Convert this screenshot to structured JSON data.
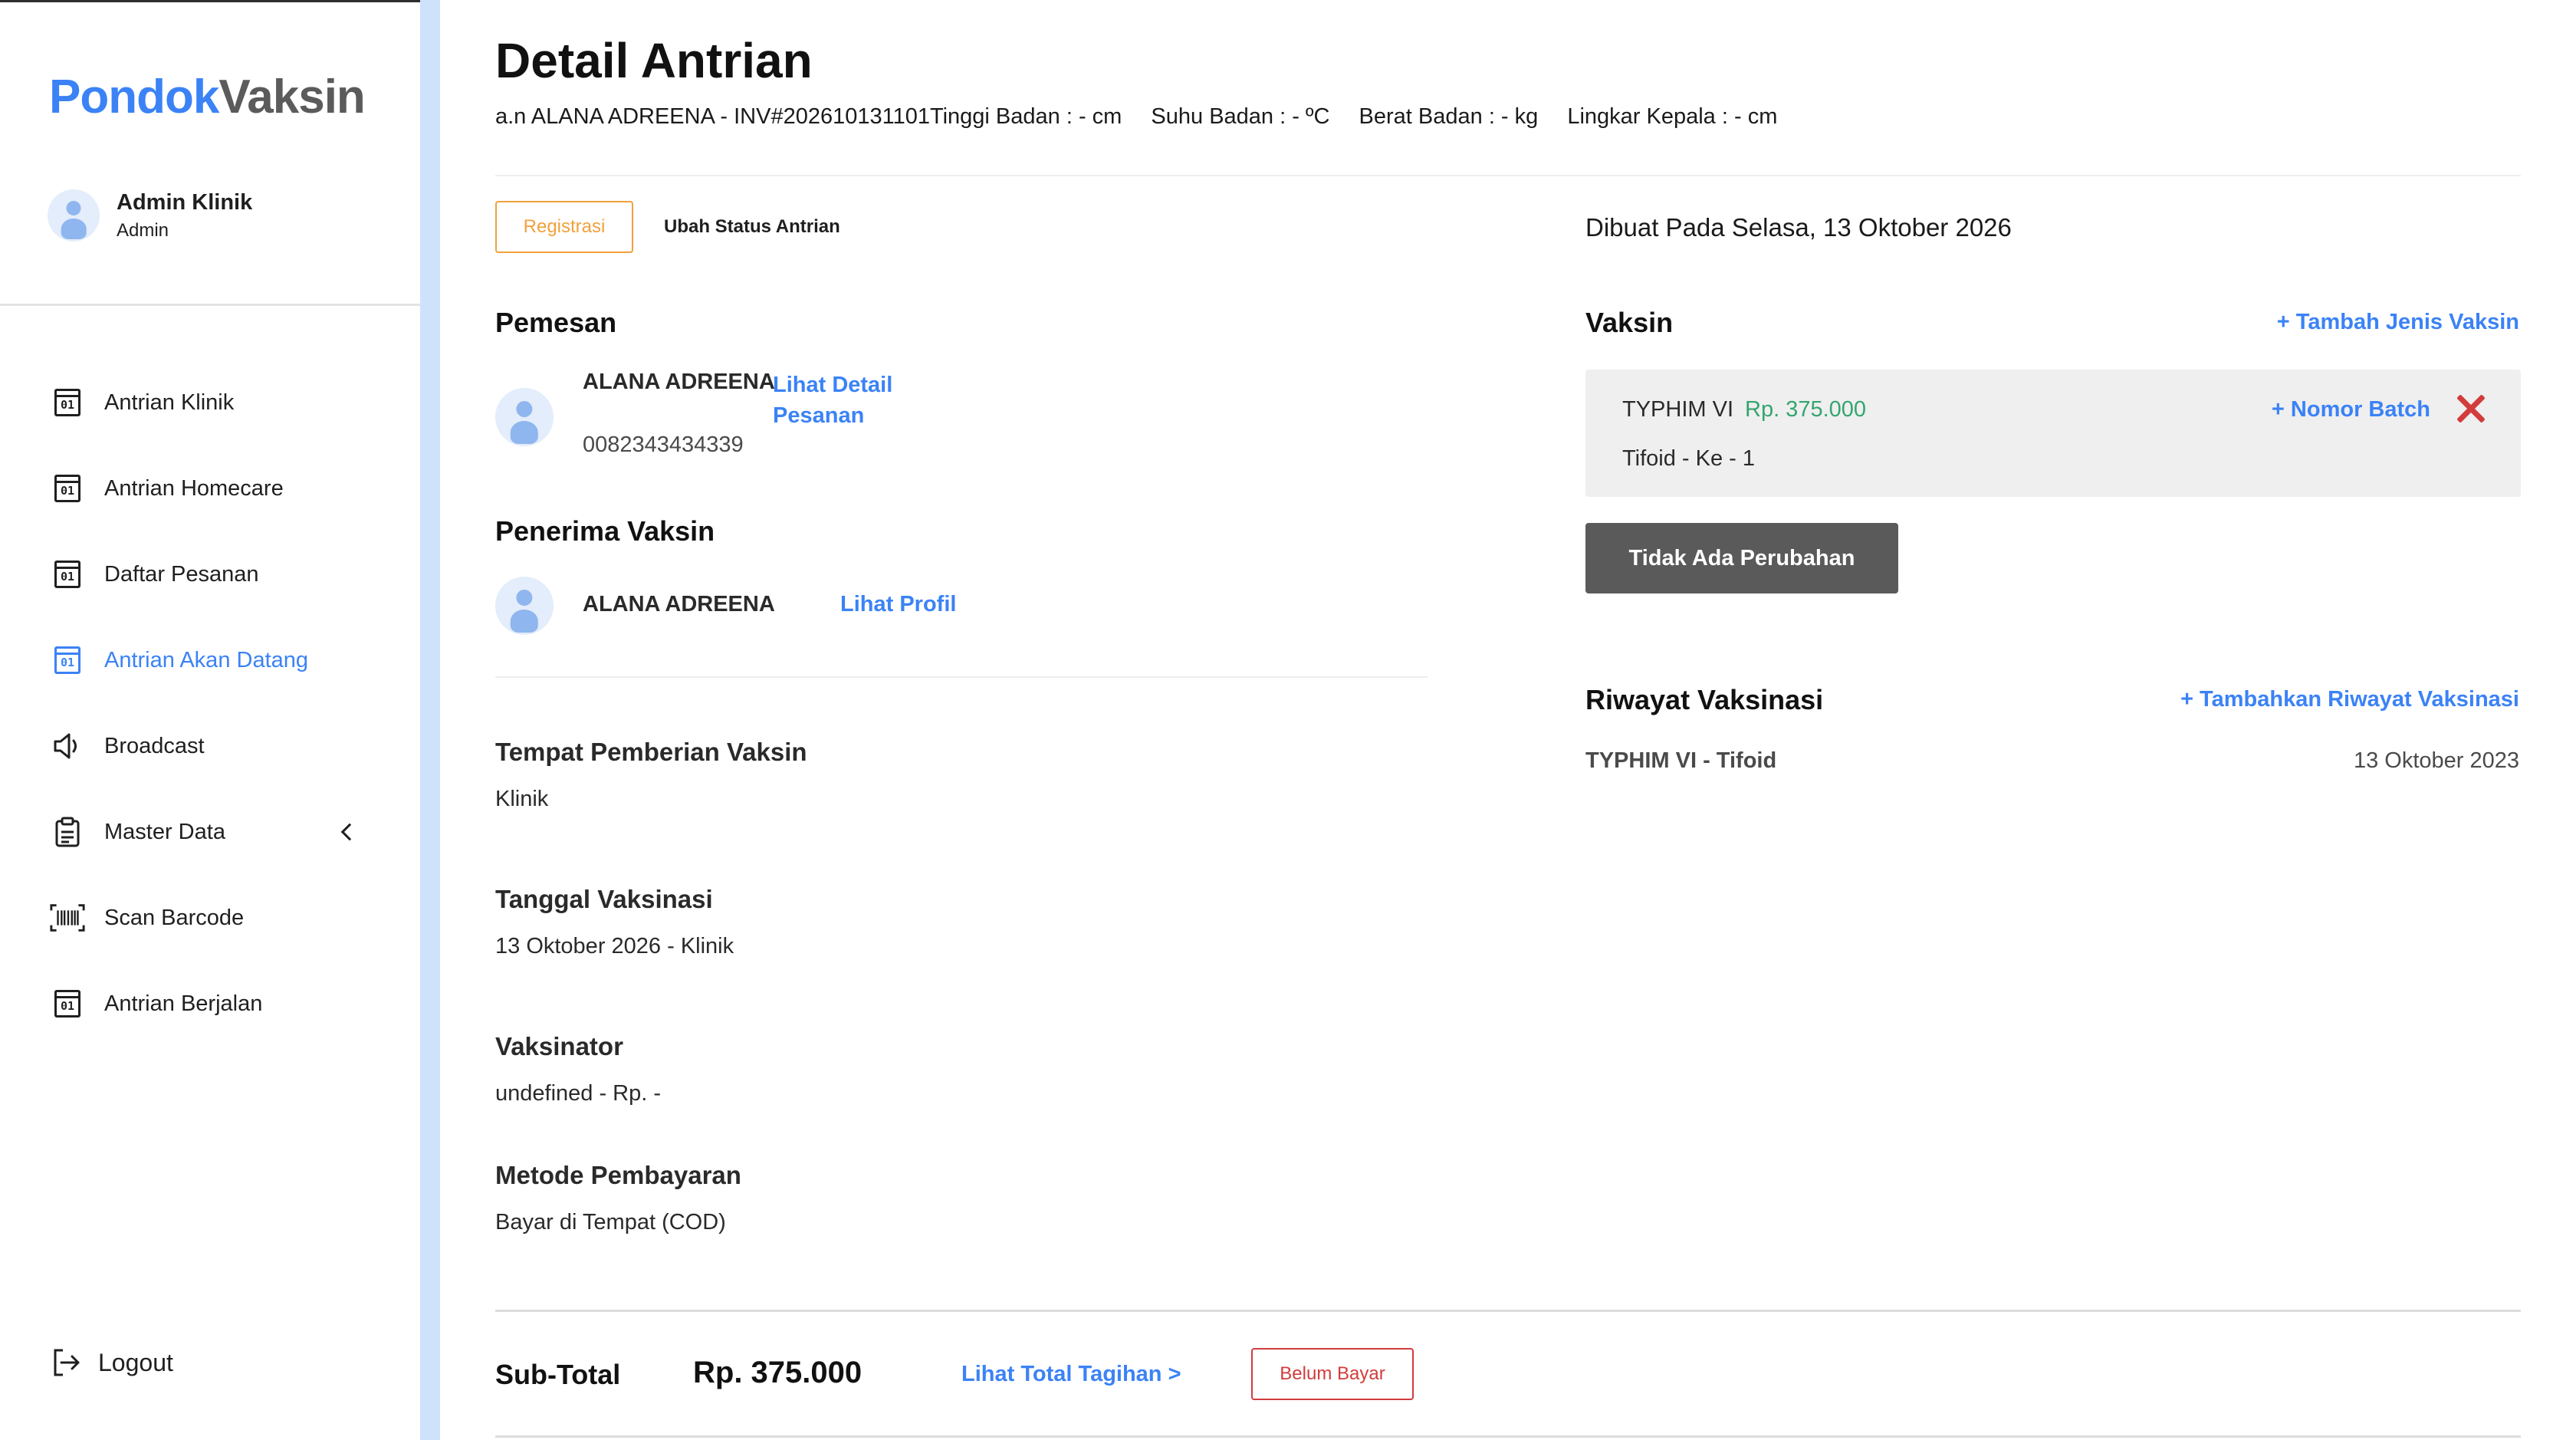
{
  "app": {
    "logo_part1": "Pondok",
    "logo_part2": "Vaksin",
    "brand_color": "#3b82f6"
  },
  "user": {
    "name": "Admin Klinik",
    "role": "Admin"
  },
  "sidebar": {
    "items": [
      {
        "label": "Antrian Klinik",
        "icon": "calendar-icon",
        "active": false
      },
      {
        "label": "Antrian Homecare",
        "icon": "calendar-icon",
        "active": false
      },
      {
        "label": "Daftar Pesanan",
        "icon": "calendar-icon",
        "active": false
      },
      {
        "label": "Antrian Akan Datang",
        "icon": "calendar-icon",
        "active": true
      },
      {
        "label": "Broadcast",
        "icon": "speaker-icon",
        "active": false
      },
      {
        "label": "Master Data",
        "icon": "clipboard-icon",
        "active": false
      },
      {
        "label": "Scan Barcode",
        "icon": "barcode-icon",
        "active": false
      },
      {
        "label": "Antrian Berjalan",
        "icon": "calendar-icon",
        "active": false
      }
    ],
    "logout_label": "Logout"
  },
  "header": {
    "title": "Detail Antrian",
    "patient_invoice": "a.n ALANA ADREENA - INV#202610131101",
    "height": "Tinggi Badan : - cm",
    "temperature": "Suhu Badan : - ºC",
    "weight": "Berat Badan : - kg",
    "head_circumference": "Lingkar Kepala : - cm"
  },
  "tabs": {
    "registration": "Registrasi",
    "change_status": "Ubah Status Antrian"
  },
  "created_at": "Dibuat Pada Selasa, 13 Oktober 2026",
  "orderer": {
    "heading": "Pemesan",
    "name": "ALANA ADREENA",
    "detail_link_line1": "Lihat Detail",
    "detail_link_line2": "Pesanan",
    "phone": "0082343434339"
  },
  "recipient": {
    "heading": "Penerima Vaksin",
    "name": "ALANA ADREENA",
    "profile_link": "Lihat Profil"
  },
  "place": {
    "heading": "Tempat Pemberian Vaksin",
    "value": "Klinik"
  },
  "date": {
    "heading": "Tanggal Vaksinasi",
    "value": "13 Oktober 2026 - Klinik"
  },
  "vaccinator": {
    "heading": "Vaksinator",
    "value": "undefined - Rp. -"
  },
  "payment": {
    "heading": "Metode Pembayaran",
    "value": "Bayar di Tempat (COD)"
  },
  "vaccine": {
    "heading": "Vaksin",
    "add_link": "+ Tambah Jenis Vaksin",
    "item": {
      "name": "TYPHIM VI",
      "price": "Rp. 375.000",
      "batch_link": "+ Nomor Batch",
      "subtitle": "Tifoid - Ke - 1"
    },
    "no_change_button": "Tidak Ada Perubahan"
  },
  "history": {
    "heading": "Riwayat Vaksinasi",
    "add_link": "+ Tambahkan Riwayat Vaksinasi",
    "rows": [
      {
        "vaccine": "TYPHIM VI - Tifoid",
        "date": "13 Oktober 2023"
      }
    ]
  },
  "footer": {
    "subtotal_label": "Sub-Total",
    "subtotal_value": "Rp. 375.000",
    "total_link": "Lihat Total Tagihan >",
    "payment_status": "Belum Bayar",
    "status_color": "#d23c3c"
  }
}
